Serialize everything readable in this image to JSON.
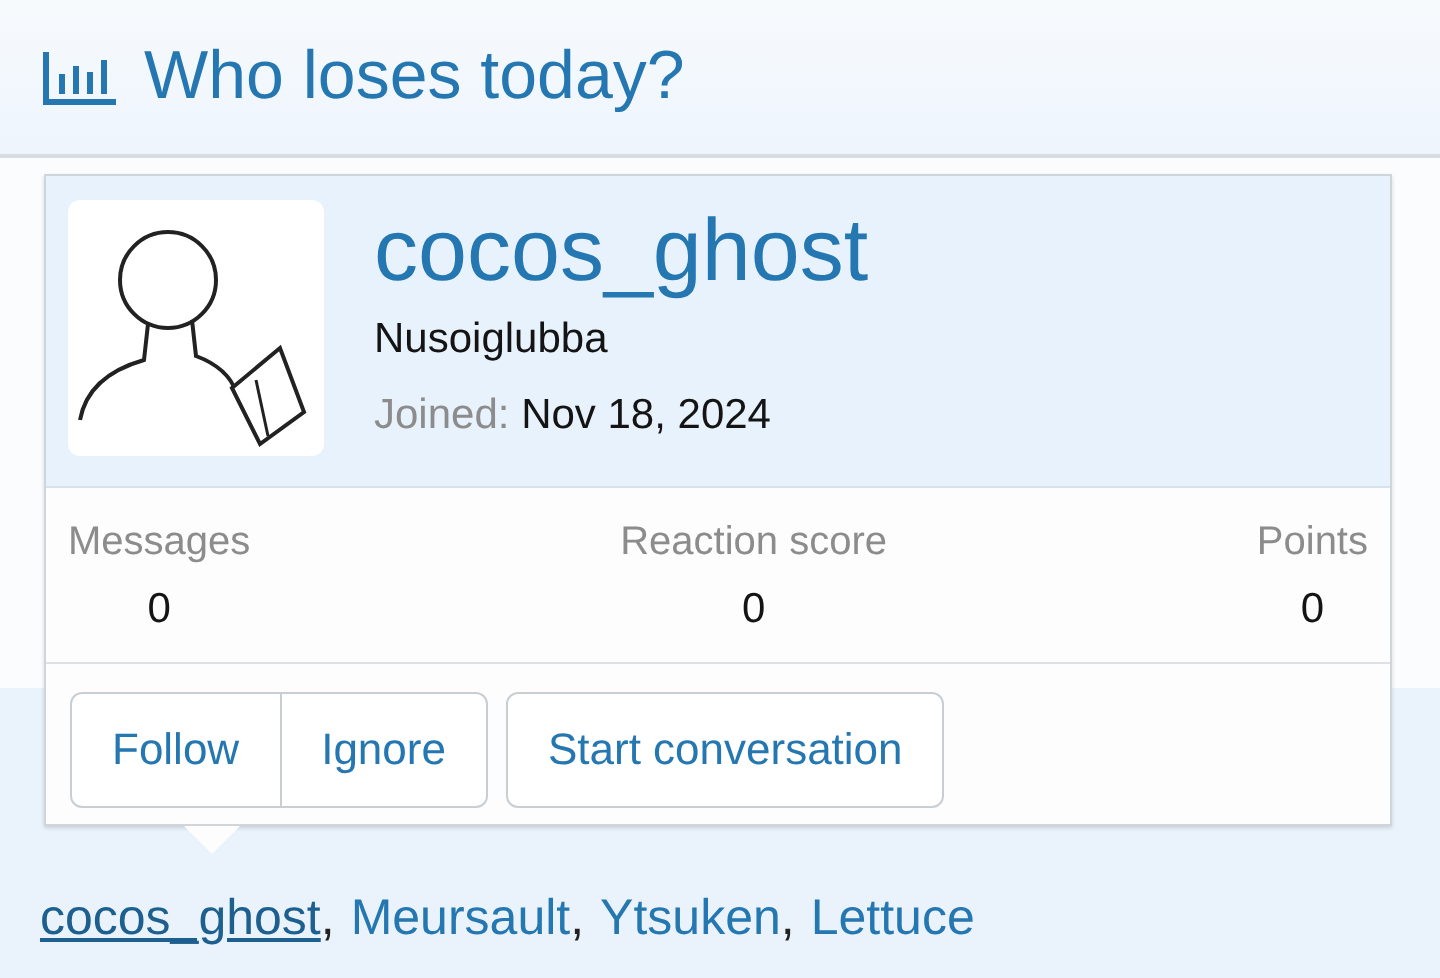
{
  "header": {
    "title": "Who loses today?"
  },
  "popup": {
    "username": "cocos_ghost",
    "user_title": "Nusoiglubba",
    "joined_label": "Joined:",
    "joined_value": "Nov 18, 2024",
    "stats": [
      {
        "label": "Messages",
        "value": "0"
      },
      {
        "label": "Reaction score",
        "value": "0"
      },
      {
        "label": "Points",
        "value": "0"
      }
    ],
    "buttons": [
      {
        "label": "Follow",
        "kind": "grouped"
      },
      {
        "label": "Ignore",
        "kind": "grouped"
      },
      {
        "label": "Start conversation",
        "kind": "single"
      }
    ]
  },
  "voters": [
    {
      "name": "cocos_ghost",
      "selected": true,
      "separator": ","
    },
    {
      "name": "Meursault",
      "selected": false,
      "separator": ","
    },
    {
      "name": "Ytsuken",
      "selected": false,
      "separator": ","
    },
    {
      "name": "Lettuce",
      "selected": false
    }
  ]
}
